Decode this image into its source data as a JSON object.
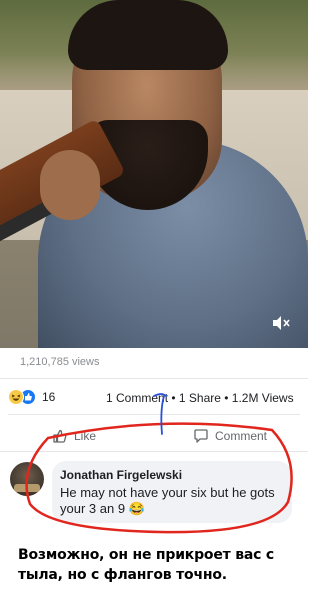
{
  "video": {
    "mute_icon": "speaker-muted-icon",
    "views_label": "1,210,785 views"
  },
  "reactions": {
    "icons": [
      "haha-reaction-icon",
      "like-reaction-icon"
    ],
    "count": "16"
  },
  "stats": {
    "text": "1 Comment • 1 Share • 1.2M Views"
  },
  "actions": {
    "like_label": "Like",
    "comment_label": "Comment"
  },
  "comment": {
    "author": "Jonathan Firgelewski",
    "text": "He may not have your six but he gots your 3 an 9 😂"
  },
  "caption": {
    "text": "Возможно, он не прикроет вас с тыла, но с флангов точно."
  },
  "colors": {
    "annotation_red": "#e0261d",
    "annotation_blue": "#2a4fd6",
    "like_blue": "#1877f2",
    "muted_text": "#65676b"
  }
}
